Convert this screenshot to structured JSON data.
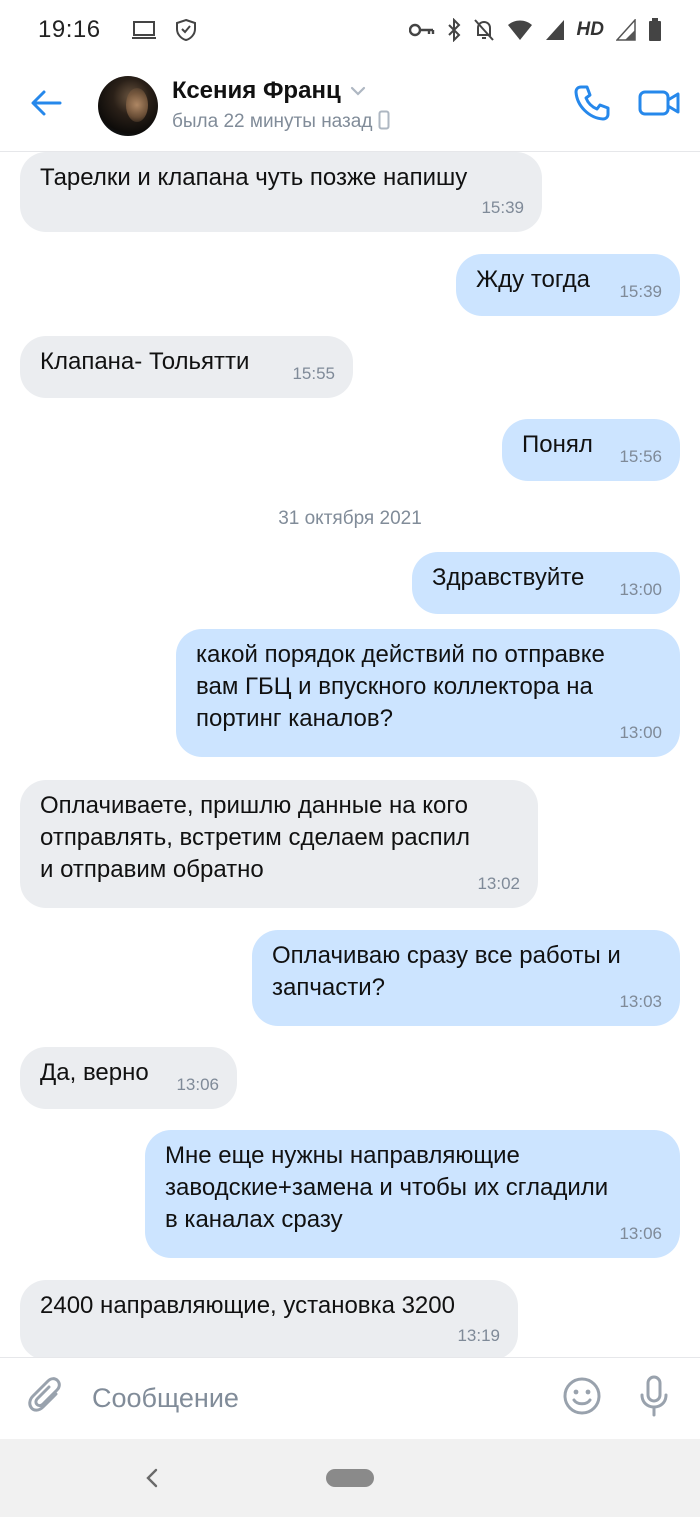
{
  "status_bar": {
    "time": "19:16",
    "hd": "HD",
    "icons": [
      "laptop-icon",
      "shield-icon",
      "key-icon",
      "bluetooth-icon",
      "mute-icon",
      "wifi-icon",
      "signal-icon",
      "battery-icon"
    ]
  },
  "header": {
    "contact_name": "Ксения Франц",
    "contact_status": "была 22 минуты назад",
    "icons": [
      "back-arrow-icon",
      "chevron-down-icon",
      "mobile-phone-icon",
      "phone-icon",
      "video-camera-icon"
    ],
    "accent_color": "#2688eb"
  },
  "messages": [
    {
      "direction": "in",
      "text": "Тарелки и клапана чуть позже напишу",
      "time": "15:39"
    },
    {
      "direction": "out",
      "text": "Жду тогда",
      "time": "15:39"
    },
    {
      "direction": "in",
      "text": "Клапана- Тольятти",
      "time": "15:55"
    },
    {
      "direction": "out",
      "text": "Понял",
      "time": "15:56"
    },
    {
      "direction": "out",
      "text": "Здравствуйте",
      "time": "13:00"
    },
    {
      "direction": "out",
      "text": "какой порядок действий по отправке\nвам ГБЦ и впускного коллектора на\nпортинг каналов?",
      "time": "13:00"
    },
    {
      "direction": "in",
      "text": "Оплачиваете, пришлю данные на кого\nотправлять, встретим сделаем распил\nи отправим обратно",
      "time": "13:02"
    },
    {
      "direction": "out",
      "text": "Оплачиваю сразу все работы и\nзапчасти?",
      "time": "13:03"
    },
    {
      "direction": "in",
      "text": "Да, верно",
      "time": "13:06"
    },
    {
      "direction": "out",
      "text": "Мне еще нужны направляющие\nзаводские+замена и чтобы их сгладили\nв каналах сразу",
      "time": "13:06"
    },
    {
      "direction": "in",
      "text": "2400 направляющие, установка 3200",
      "time": "13:19"
    }
  ],
  "date_separator": "31 октября 2021",
  "composer": {
    "placeholder": "Сообщение",
    "icons": [
      "paperclip-icon",
      "smiley-icon",
      "microphone-icon"
    ]
  },
  "colors": {
    "incoming_bubble": "#ebedf0",
    "outgoing_bubble": "#cce4ff",
    "secondary_text": "#818c99"
  }
}
